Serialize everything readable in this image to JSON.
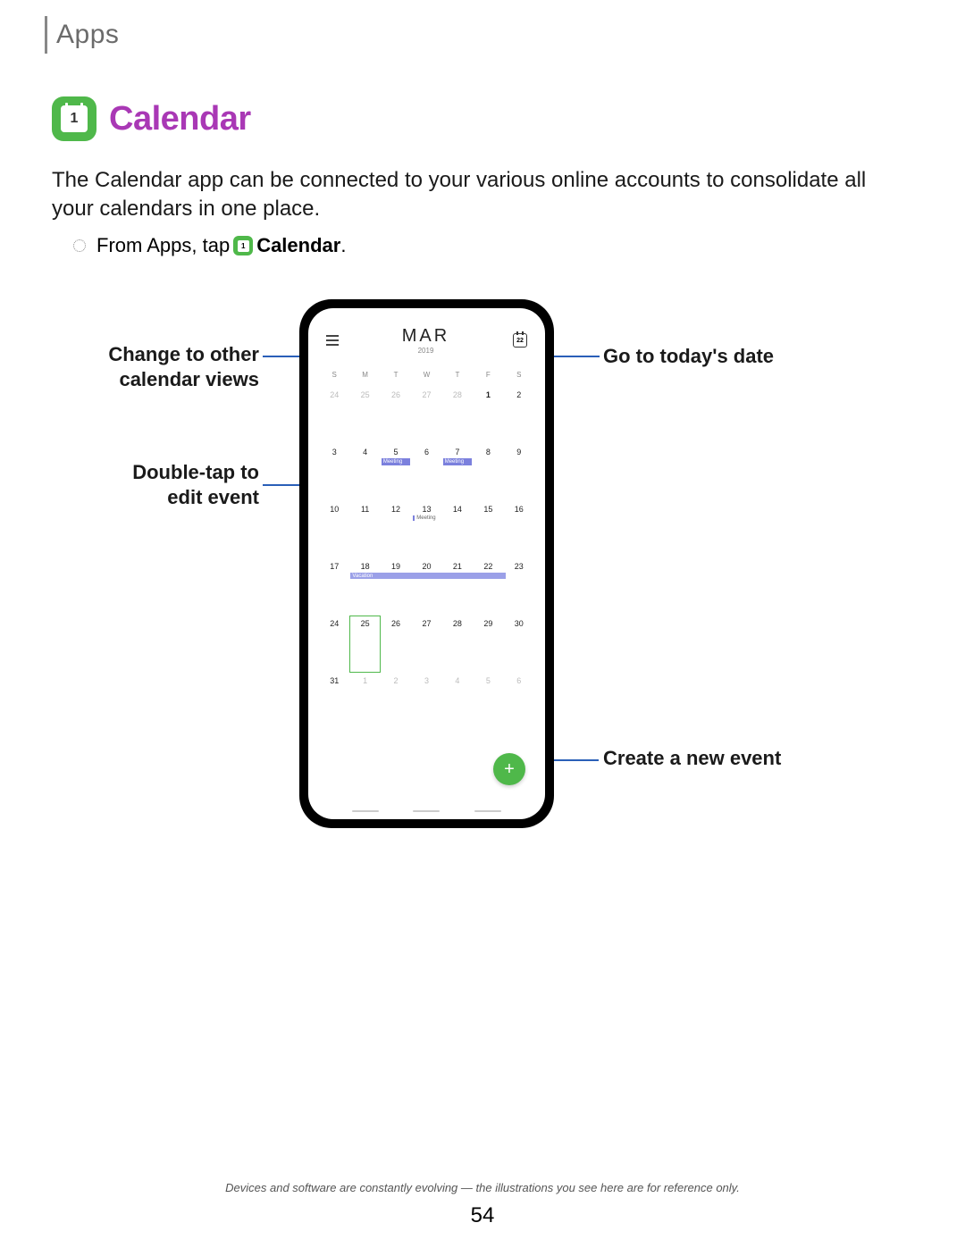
{
  "header": {
    "section": "Apps"
  },
  "title": {
    "app_name": "Calendar",
    "icon_number": "1"
  },
  "intro": "The Calendar app can be connected to your various online accounts to consolidate all your calendars in one place.",
  "instruction": {
    "prefix": "From Apps, tap",
    "app_label": "Calendar",
    "icon_number": "1",
    "suffix": "."
  },
  "screenshot": {
    "month": "MAR",
    "year": "2019",
    "today_badge": "22",
    "days_of_week": [
      "S",
      "M",
      "T",
      "W",
      "T",
      "F",
      "S"
    ],
    "weeks": [
      [
        {
          "n": "24",
          "dim": true
        },
        {
          "n": "25",
          "dim": true
        },
        {
          "n": "26",
          "dim": true
        },
        {
          "n": "27",
          "dim": true
        },
        {
          "n": "28",
          "dim": true
        },
        {
          "n": "1",
          "bold": true
        },
        {
          "n": "2"
        }
      ],
      [
        {
          "n": "3"
        },
        {
          "n": "4"
        },
        {
          "n": "5",
          "ev": "Meeting"
        },
        {
          "n": "6"
        },
        {
          "n": "7",
          "ev": "Meeting"
        },
        {
          "n": "8"
        },
        {
          "n": "9"
        }
      ],
      [
        {
          "n": "10"
        },
        {
          "n": "11"
        },
        {
          "n": "12"
        },
        {
          "n": "13",
          "evtxt": "Meeting"
        },
        {
          "n": "14"
        },
        {
          "n": "15"
        },
        {
          "n": "16"
        }
      ],
      [
        {
          "n": "17"
        },
        {
          "n": "18"
        },
        {
          "n": "19"
        },
        {
          "n": "20"
        },
        {
          "n": "21"
        },
        {
          "n": "22"
        },
        {
          "n": "23"
        }
      ],
      [
        {
          "n": "24"
        },
        {
          "n": "25",
          "today": true
        },
        {
          "n": "26"
        },
        {
          "n": "27"
        },
        {
          "n": "28"
        },
        {
          "n": "29"
        },
        {
          "n": "30"
        }
      ],
      [
        {
          "n": "31"
        },
        {
          "n": "1",
          "dim": true
        },
        {
          "n": "2",
          "dim": true
        },
        {
          "n": "3",
          "dim": true
        },
        {
          "n": "4",
          "dim": true
        },
        {
          "n": "5",
          "dim": true
        },
        {
          "n": "6",
          "dim": true
        }
      ]
    ],
    "vacation_label": "Vacation",
    "fab_label": "+"
  },
  "callouts": {
    "views": "Change to other calendar views",
    "today": "Go to today's date",
    "edit": "Double-tap to edit event",
    "create": "Create a new event"
  },
  "footnote": "Devices and software are constantly evolving — the illustrations you see here are for reference only.",
  "page_number": "54"
}
